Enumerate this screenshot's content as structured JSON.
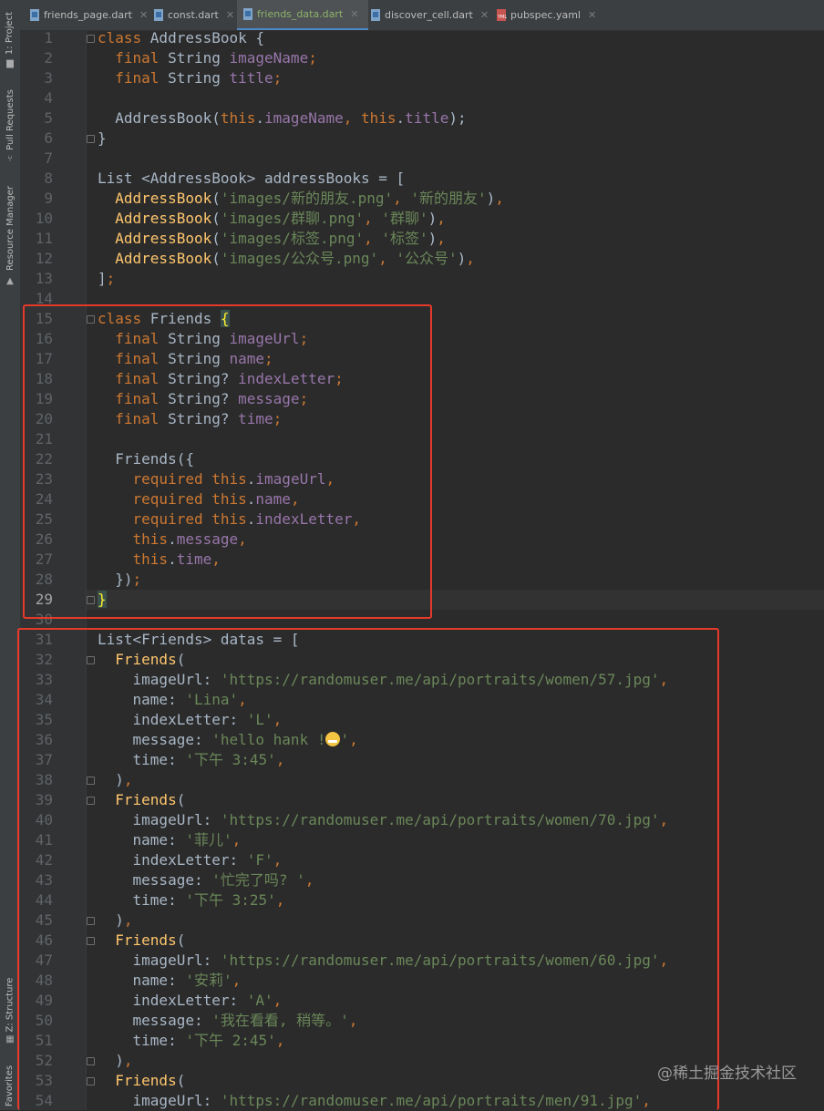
{
  "sidebar": {
    "items": [
      "1: Project",
      "Pull Requests",
      "Resource Manager",
      "Z: Structure",
      "Favorites"
    ]
  },
  "tabs": [
    {
      "label": "friends_page.dart",
      "icon": "dart-file-icon",
      "active": false
    },
    {
      "label": "const.dart",
      "icon": "dart-file-icon",
      "active": false
    },
    {
      "label": "friends_data.dart",
      "icon": "dart-file-icon",
      "active": true
    },
    {
      "label": "discover_cell.dart",
      "icon": "dart-file-icon",
      "active": false
    },
    {
      "label": "pubspec.yaml",
      "icon": "yaml-file-icon",
      "active": false
    }
  ],
  "colors": {
    "keyword": "#cc7832",
    "class_name": "#ffc66d",
    "string": "#6a8759",
    "field": "#9876aa",
    "plain": "#a9b7c6",
    "highlight_box": "#e53a2a",
    "active_tab_underline": "#4a88c7"
  },
  "current_line": 29,
  "code": [
    [
      [
        "k",
        "class "
      ],
      [
        "p",
        "AddressBook {"
      ]
    ],
    [
      [
        "k",
        "  final "
      ],
      [
        "p",
        "String "
      ],
      [
        "f",
        "imageName"
      ],
      [
        "k",
        ";"
      ]
    ],
    [
      [
        "k",
        "  final "
      ],
      [
        "p",
        "String "
      ],
      [
        "f",
        "title"
      ],
      [
        "k",
        ";"
      ]
    ],
    [],
    [
      [
        "p",
        "  AddressBook("
      ],
      [
        "k",
        "this"
      ],
      [
        "p",
        "."
      ],
      [
        "f",
        "imageName"
      ],
      [
        "k",
        ", "
      ],
      [
        "k",
        "this"
      ],
      [
        "p",
        "."
      ],
      [
        "f",
        "title"
      ],
      [
        "p",
        ");"
      ]
    ],
    [
      [
        "p",
        "}"
      ]
    ],
    [],
    [
      [
        "p",
        "List <AddressBook> addressBooks = ["
      ]
    ],
    [
      [
        "c",
        "  AddressBook"
      ],
      [
        "p",
        "("
      ],
      [
        "s",
        "'images/新的朋友.png'"
      ],
      [
        "k",
        ", "
      ],
      [
        "s",
        "'新的朋友'"
      ],
      [
        "p",
        ")"
      ],
      [
        "k",
        ","
      ]
    ],
    [
      [
        "c",
        "  AddressBook"
      ],
      [
        "p",
        "("
      ],
      [
        "s",
        "'images/群聊.png'"
      ],
      [
        "k",
        ", "
      ],
      [
        "s",
        "'群聊'"
      ],
      [
        "p",
        ")"
      ],
      [
        "k",
        ","
      ]
    ],
    [
      [
        "c",
        "  AddressBook"
      ],
      [
        "p",
        "("
      ],
      [
        "s",
        "'images/标签.png'"
      ],
      [
        "k",
        ", "
      ],
      [
        "s",
        "'标签'"
      ],
      [
        "p",
        ")"
      ],
      [
        "k",
        ","
      ]
    ],
    [
      [
        "c",
        "  AddressBook"
      ],
      [
        "p",
        "("
      ],
      [
        "s",
        "'images/公众号.png'"
      ],
      [
        "k",
        ", "
      ],
      [
        "s",
        "'公众号'"
      ],
      [
        "p",
        ")"
      ],
      [
        "k",
        ","
      ]
    ],
    [
      [
        "p",
        "]"
      ],
      [
        "k",
        ";"
      ]
    ],
    [],
    [
      [
        "k",
        "class "
      ],
      [
        "p",
        "Friends "
      ],
      [
        "hl",
        "{"
      ]
    ],
    [
      [
        "k",
        "  final "
      ],
      [
        "p",
        "String "
      ],
      [
        "f",
        "imageUrl"
      ],
      [
        "k",
        ";"
      ]
    ],
    [
      [
        "k",
        "  final "
      ],
      [
        "p",
        "String "
      ],
      [
        "f",
        "name"
      ],
      [
        "k",
        ";"
      ]
    ],
    [
      [
        "k",
        "  final "
      ],
      [
        "p",
        "String? "
      ],
      [
        "f",
        "indexLetter"
      ],
      [
        "k",
        ";"
      ]
    ],
    [
      [
        "k",
        "  final "
      ],
      [
        "p",
        "String? "
      ],
      [
        "f",
        "message"
      ],
      [
        "k",
        ";"
      ]
    ],
    [
      [
        "k",
        "  final "
      ],
      [
        "p",
        "String? "
      ],
      [
        "f",
        "time"
      ],
      [
        "k",
        ";"
      ]
    ],
    [],
    [
      [
        "p",
        "  Friends({"
      ]
    ],
    [
      [
        "k",
        "    required this"
      ],
      [
        "p",
        "."
      ],
      [
        "f",
        "imageUrl"
      ],
      [
        "k",
        ","
      ]
    ],
    [
      [
        "k",
        "    required this"
      ],
      [
        "p",
        "."
      ],
      [
        "f",
        "name"
      ],
      [
        "k",
        ","
      ]
    ],
    [
      [
        "k",
        "    required this"
      ],
      [
        "p",
        "."
      ],
      [
        "f",
        "indexLetter"
      ],
      [
        "k",
        ","
      ]
    ],
    [
      [
        "k",
        "    this"
      ],
      [
        "p",
        "."
      ],
      [
        "f",
        "message"
      ],
      [
        "k",
        ","
      ]
    ],
    [
      [
        "k",
        "    this"
      ],
      [
        "p",
        "."
      ],
      [
        "f",
        "time"
      ],
      [
        "k",
        ","
      ]
    ],
    [
      [
        "p",
        "  })"
      ],
      [
        "k",
        ";"
      ]
    ],
    [
      [
        "hl",
        "}"
      ]
    ],
    [],
    [
      [
        "p",
        "List<Friends> datas = ["
      ]
    ],
    [
      [
        "c",
        "  Friends"
      ],
      [
        "p",
        "("
      ]
    ],
    [
      [
        "p",
        "    imageUrl: "
      ],
      [
        "s",
        "'https://randomuser.me/api/portraits/women/57.jpg'"
      ],
      [
        "k",
        ","
      ]
    ],
    [
      [
        "p",
        "    name: "
      ],
      [
        "s",
        "'Lina'"
      ],
      [
        "k",
        ","
      ]
    ],
    [
      [
        "p",
        "    indexLetter: "
      ],
      [
        "s",
        "'L'"
      ],
      [
        "k",
        ","
      ]
    ],
    [
      [
        "p",
        "    message: "
      ],
      [
        "s",
        "'hello hank !"
      ],
      [
        "emoji",
        ""
      ],
      [
        "s",
        "'"
      ],
      [
        "k",
        ","
      ]
    ],
    [
      [
        "p",
        "    time: "
      ],
      [
        "s",
        "'下午 3:45'"
      ],
      [
        "k",
        ","
      ]
    ],
    [
      [
        "p",
        "  )"
      ],
      [
        "k",
        ","
      ]
    ],
    [
      [
        "c",
        "  Friends"
      ],
      [
        "p",
        "("
      ]
    ],
    [
      [
        "p",
        "    imageUrl: "
      ],
      [
        "s",
        "'https://randomuser.me/api/portraits/women/70.jpg'"
      ],
      [
        "k",
        ","
      ]
    ],
    [
      [
        "p",
        "    name: "
      ],
      [
        "s",
        "'菲儿'"
      ],
      [
        "k",
        ","
      ]
    ],
    [
      [
        "p",
        "    indexLetter: "
      ],
      [
        "s",
        "'F'"
      ],
      [
        "k",
        ","
      ]
    ],
    [
      [
        "p",
        "    message: "
      ],
      [
        "s",
        "'忙完了吗? '"
      ],
      [
        "k",
        ","
      ]
    ],
    [
      [
        "p",
        "    time: "
      ],
      [
        "s",
        "'下午 3:25'"
      ],
      [
        "k",
        ","
      ]
    ],
    [
      [
        "p",
        "  )"
      ],
      [
        "k",
        ","
      ]
    ],
    [
      [
        "c",
        "  Friends"
      ],
      [
        "p",
        "("
      ]
    ],
    [
      [
        "p",
        "    imageUrl: "
      ],
      [
        "s",
        "'https://randomuser.me/api/portraits/women/60.jpg'"
      ],
      [
        "k",
        ","
      ]
    ],
    [
      [
        "p",
        "    name: "
      ],
      [
        "s",
        "'安莉'"
      ],
      [
        "k",
        ","
      ]
    ],
    [
      [
        "p",
        "    indexLetter: "
      ],
      [
        "s",
        "'A'"
      ],
      [
        "k",
        ","
      ]
    ],
    [
      [
        "p",
        "    message: "
      ],
      [
        "s",
        "'我在看看, 稍等。'"
      ],
      [
        "k",
        ","
      ]
    ],
    [
      [
        "p",
        "    time: "
      ],
      [
        "s",
        "'下午 2:45'"
      ],
      [
        "k",
        ","
      ]
    ],
    [
      [
        "p",
        "  )"
      ],
      [
        "k",
        ","
      ]
    ],
    [
      [
        "c",
        "  Friends"
      ],
      [
        "p",
        "("
      ]
    ],
    [
      [
        "p",
        "    imageUrl: "
      ],
      [
        "s",
        "'https://randomuser.me/api/portraits/men/91.jpg'"
      ],
      [
        "k",
        ","
      ]
    ]
  ],
  "fold_markers": [
    1,
    6,
    15,
    29,
    32,
    38,
    39,
    45,
    46,
    52,
    53
  ],
  "watermark": "@稀土掘金技术社区"
}
